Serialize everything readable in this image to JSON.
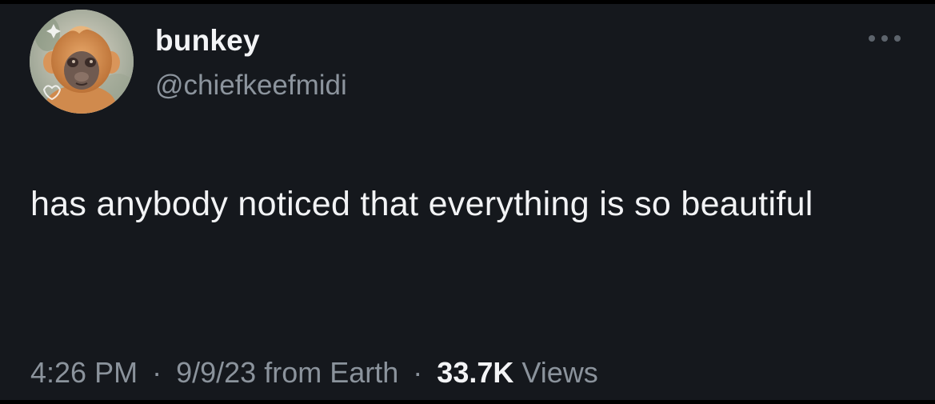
{
  "tweet": {
    "author": {
      "display_name": "bunkey",
      "handle": "@chiefkeefmidi",
      "avatar_icon": "monkey-avatar"
    },
    "text": "has anybody noticed that everything is so beautiful",
    "meta": {
      "time": "4:26 PM",
      "date": "9/9/23",
      "source": "from Earth",
      "separator": "·",
      "views_count": "33.7K",
      "views_label": "Views"
    },
    "more_icon": "more-dots-icon"
  },
  "colors": {
    "background": "#15181d",
    "primary_text": "#f2f3f5",
    "secondary_text": "#8b939c"
  }
}
